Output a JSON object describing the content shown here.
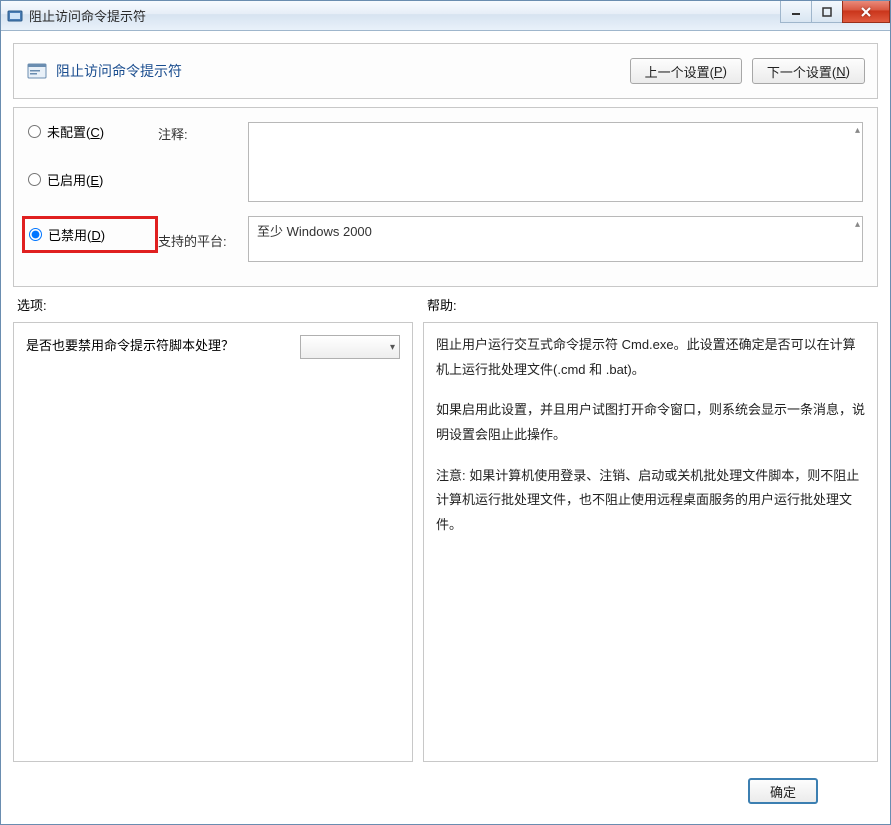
{
  "window": {
    "title": "阻止访问命令提示符"
  },
  "header": {
    "title": "阻止访问命令提示符",
    "prev_btn": "上一个设置(",
    "prev_key": "P",
    "prev_btn_end": ")",
    "next_btn": "下一个设置(",
    "next_key": "N",
    "next_btn_end": ")"
  },
  "config": {
    "not_configured_label": "未配置(",
    "not_configured_key": "C",
    "not_configured_end": ")",
    "enabled_label": "已启用(",
    "enabled_key": "E",
    "enabled_end": ")",
    "disabled_label": "已禁用(",
    "disabled_key": "D",
    "disabled_end": ")",
    "comment_label": "注释:",
    "comment_value": "",
    "platform_label": "支持的平台:",
    "platform_value": "至少 Windows 2000"
  },
  "sections": {
    "options_label": "选项:",
    "help_label": "帮助:"
  },
  "options": {
    "question": "是否也要禁用命令提示符脚本处理？",
    "combo_value": ""
  },
  "help": {
    "p1": "阻止用户运行交互式命令提示符 Cmd.exe。此设置还确定是否可以在计算机上运行批处理文件(.cmd 和 .bat)。",
    "p2": "如果启用此设置，并且用户试图打开命令窗口，则系统会显示一条消息，说明设置会阻止此操作。",
    "p3": "注意: 如果计算机使用登录、注销、启动或关机批处理文件脚本，则不阻止计算机运行批处理文件，也不阻止使用远程桌面服务的用户运行批处理文件。"
  },
  "footer": {
    "ok": "确定"
  }
}
